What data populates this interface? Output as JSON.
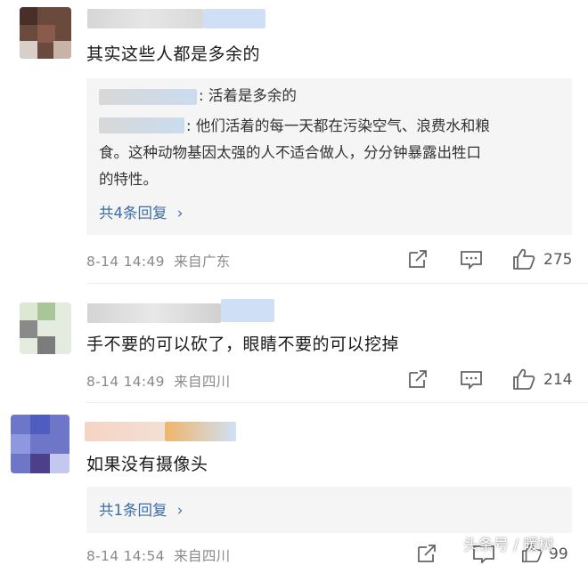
{
  "comments": [
    {
      "text": "其实这些人都是多余的",
      "reply_preview": [
        {
          "name_suffix": ":",
          "text": "活着是多余的"
        },
        {
          "name_suffix": ":",
          "text_line1": "他们活着的每一天都在污染空气、浪费水和粮",
          "text_line2": "食。这种动物基因太强的人不适合做人，分分钟暴露出牲口",
          "text_line3": "的特性。"
        }
      ],
      "reply_more": "共4条回复",
      "time": "8-14 14:49",
      "source": "来自广东",
      "likes": "275"
    },
    {
      "text": "手不要的可以砍了，眼睛不要的可以挖掉",
      "time": "8-14 14:49",
      "source": "来自四川",
      "likes": "214"
    },
    {
      "text": "如果没有摄像头",
      "reply_more": "共1条回复",
      "time": "8-14 14:54",
      "source": "来自四川",
      "likes": "99"
    }
  ],
  "icons": {
    "share": "share-icon",
    "reply": "comment-icon",
    "like": "thumbs-up-icon",
    "chevron": "chevron-right-icon"
  },
  "watermark": "头条号 / 暖树",
  "colors": {
    "link": "#3a6ea5",
    "meta": "#8a8a8a",
    "reply_bg": "#f5f5f5"
  }
}
